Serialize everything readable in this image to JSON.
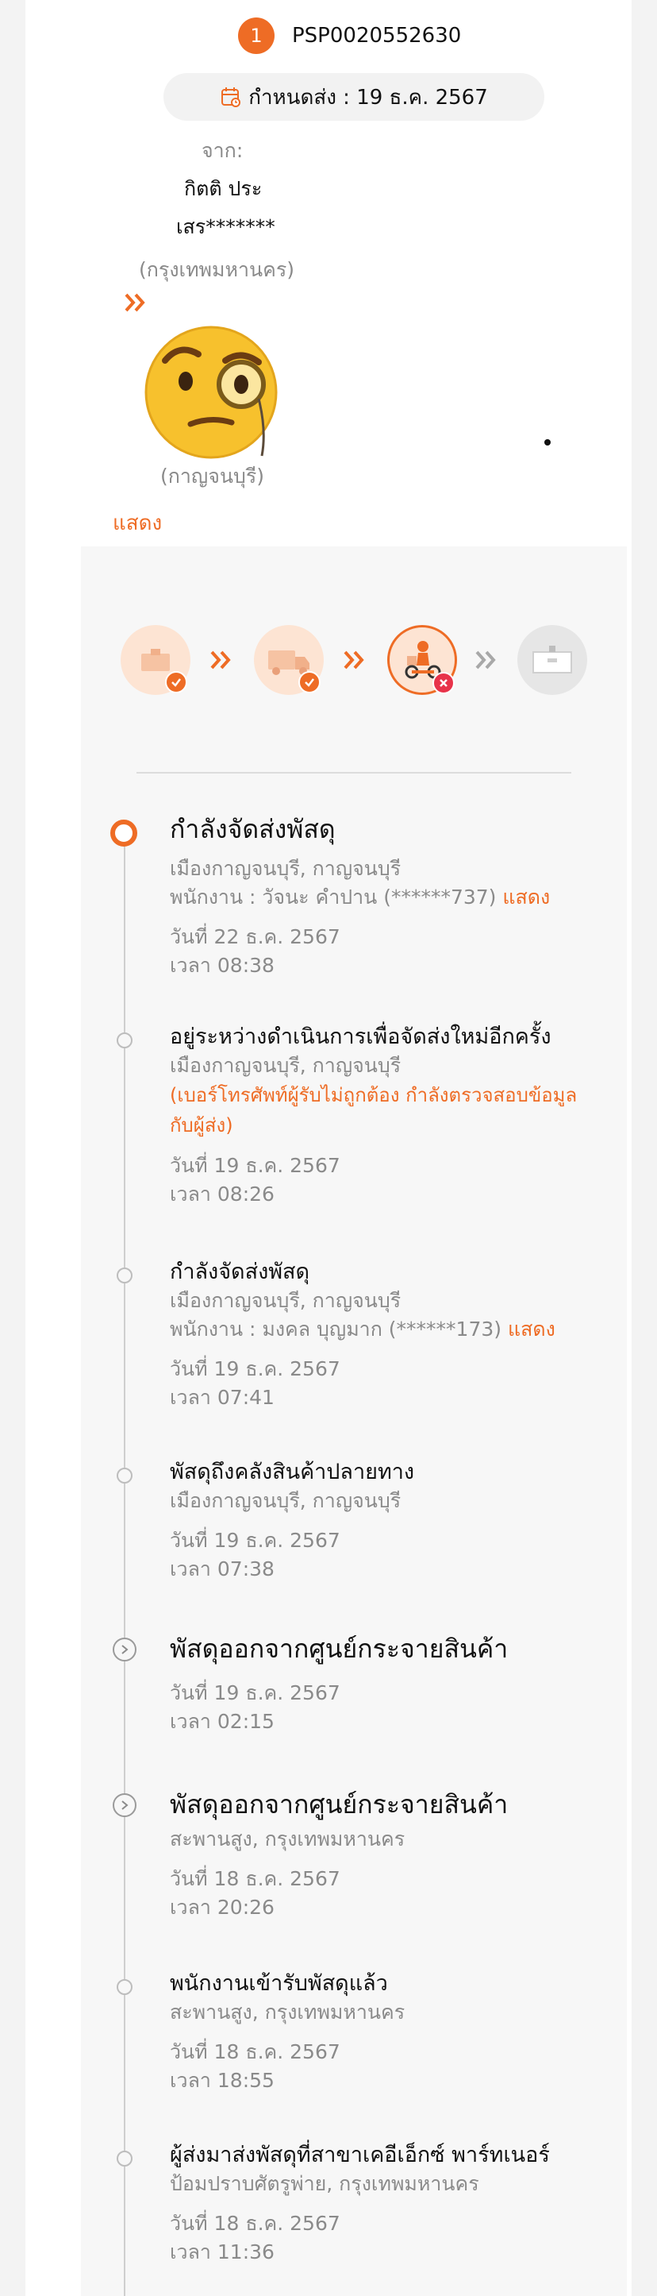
{
  "header": {
    "badge_number": "1",
    "tracking_number": "PSP0020552630",
    "due_date_label": "กำหนดส่ง : 19 ธ.ค. 2567"
  },
  "sender": {
    "from_label": "จาก:",
    "name_line1": "กิตติ ประ",
    "name_line2": "เสร*******",
    "province": "(กรุงเทพมหานคร)"
  },
  "receiver": {
    "province": "(กาญจนบุรี)"
  },
  "show_label": "แสดง",
  "steps": [
    {
      "icon": "box-packed-icon",
      "state": "done"
    },
    {
      "icon": "truck-icon",
      "state": "done"
    },
    {
      "icon": "delivery-rider-icon",
      "state": "failed"
    },
    {
      "icon": "delivered-box-icon",
      "state": "pending"
    }
  ],
  "colors": {
    "accent": "#ee6c25",
    "muted": "#8a8a8a",
    "failed": "#e8334a"
  },
  "events": [
    {
      "title": "กำลังจัดส่งพัสดุ",
      "location": "เมืองกาญจนบุรี, กาญจนบุรี",
      "staff": "พนักงาน : วัจนะ คำปาน (******737)",
      "staff_link": "แสดง",
      "date": "วันที่ 22 ธ.ค. 2567",
      "time": "เวลา 08:38"
    },
    {
      "title": "อยู่ระหว่างดำเนินการเพื่อจัดส่งใหม่อีกครั้ง",
      "location": "เมืองกาญจนบุรี, กาญจนบุรี",
      "note": "(เบอร์โทรศัพท์ผู้รับไม่ถูกต้อง กำลังตรวจสอบข้อมูลกับผู้ส่ง)",
      "date": "วันที่ 19 ธ.ค. 2567",
      "time": "เวลา 08:26"
    },
    {
      "title": "กำลังจัดส่งพัสดุ",
      "location": "เมืองกาญจนบุรี, กาญจนบุรี",
      "staff": "พนักงาน : มงคล บุญมาก (******173)",
      "staff_link": "แสดง",
      "date": "วันที่ 19 ธ.ค. 2567",
      "time": "เวลา 07:41"
    },
    {
      "title": "พัสดุถึงคลังสินค้าปลายทาง",
      "location": "เมืองกาญจนบุรี, กาญจนบุรี",
      "date": "วันที่ 19 ธ.ค. 2567",
      "time": "เวลา 07:38"
    },
    {
      "title": "พัสดุออกจากศูนย์กระจายสินค้า",
      "date": "วันที่ 19 ธ.ค. 2567",
      "time": "เวลา 02:15"
    },
    {
      "title": "พัสดุออกจากศูนย์กระจายสินค้า",
      "location": "สะพานสูง, กรุงเทพมหานคร",
      "date": "วันที่ 18 ธ.ค. 2567",
      "time": "เวลา 20:26"
    },
    {
      "title": "พนักงานเข้ารับพัสดุแล้ว",
      "location": "สะพานสูง, กรุงเทพมหานคร",
      "date": "วันที่ 18 ธ.ค. 2567",
      "time": "เวลา 18:55"
    },
    {
      "title": "ผู้ส่งมาส่งพัสดุที่สาขาเคอีเอ็กซ์ พาร์ทเนอร์",
      "location": "ป้อมปราบศัตรูพ่าย, กรุงเทพมหานคร",
      "date": "วันที่ 18 ธ.ค. 2567",
      "time": "เวลา 11:36"
    }
  ]
}
